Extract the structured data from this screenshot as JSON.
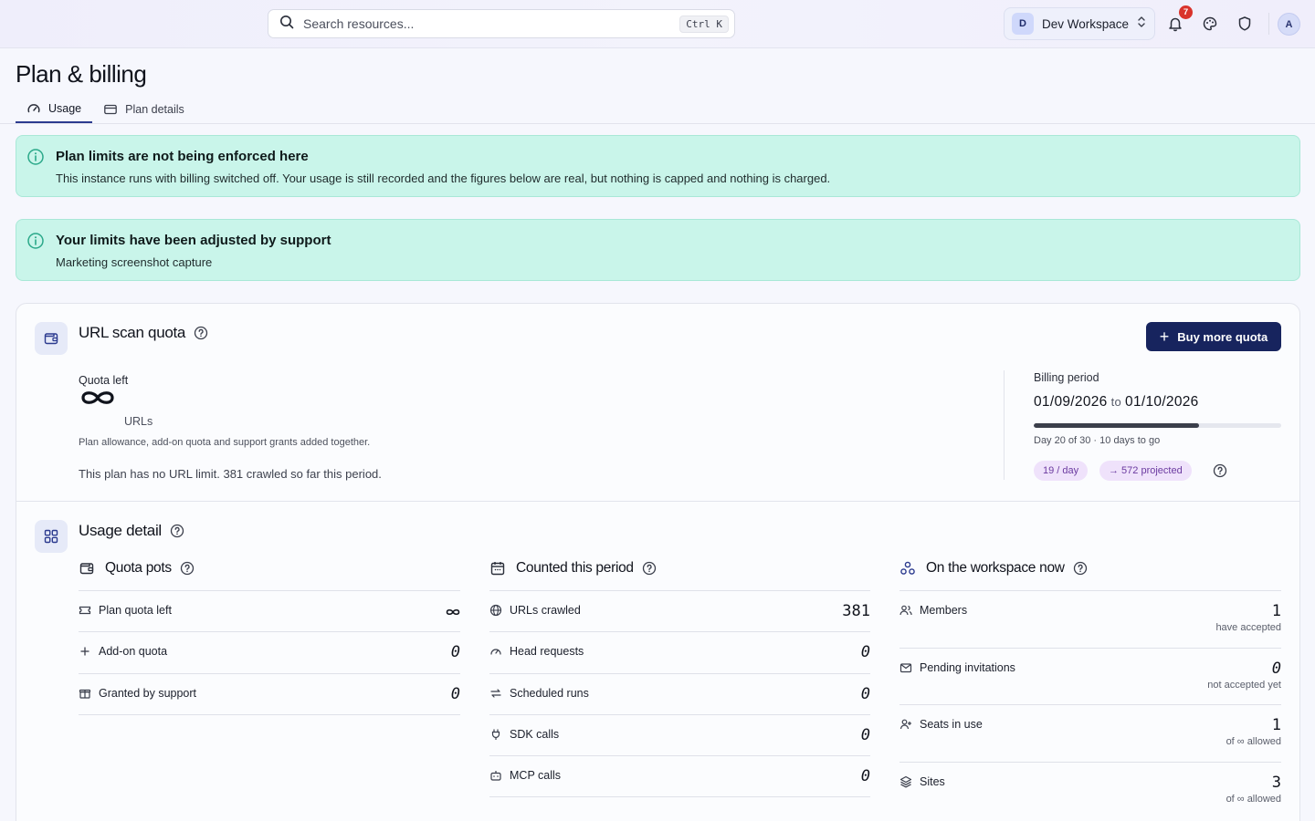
{
  "topbar": {
    "search_placeholder": "Search resources...",
    "search_shortcut": "Ctrl K",
    "workspace_initial": "D",
    "workspace_name": "Dev Workspace",
    "notification_count": "7",
    "user_initial": "A"
  },
  "page": {
    "title": "Plan & billing",
    "tabs": [
      {
        "label": "Usage",
        "icon": "gauge-icon",
        "active": true
      },
      {
        "label": "Plan details",
        "icon": "credit-card-icon",
        "active": false
      }
    ]
  },
  "alerts": [
    {
      "title": "Plan limits are not being enforced here",
      "body": "This instance runs with billing switched off. Your usage is still recorded and the figures below are real, but nothing is capped and nothing is charged."
    },
    {
      "title": "Your limits have been adjusted by support",
      "body": "Marketing screenshot capture"
    }
  ],
  "quota": {
    "title": "URL scan quota",
    "buy_label": "Buy more quota",
    "quota_left_label": "Quota left",
    "quota_left_value": "∞",
    "unit": "URLs",
    "sub": "Plan allowance, add-on quota and support grants added together.",
    "note": "This plan has no URL limit. 381 crawled so far this period.",
    "billing": {
      "label": "Billing period",
      "start": "01/09/2026",
      "to": "to",
      "end": "01/10/2026",
      "progress_fraction": 0.667,
      "days_text": "Day 20 of 30 · 10 days to go",
      "rate": "19 / day",
      "projected": "→ 572 projected"
    }
  },
  "usage": {
    "title": "Usage detail",
    "pots": {
      "title": "Quota pots",
      "rows": [
        {
          "label": "Plan quota left",
          "value": "∞",
          "icon": "ticket-icon"
        },
        {
          "label": "Add-on quota",
          "value": "0",
          "icon": "plus-icon"
        },
        {
          "label": "Granted by support",
          "value": "0",
          "icon": "gift-icon"
        }
      ]
    },
    "counted": {
      "title": "Counted this period",
      "rows": [
        {
          "label": "URLs crawled",
          "value": "381",
          "icon": "globe-icon"
        },
        {
          "label": "Head requests",
          "value": "0",
          "icon": "gauge-icon"
        },
        {
          "label": "Scheduled runs",
          "value": "0",
          "icon": "repeat-icon"
        },
        {
          "label": "SDK calls",
          "value": "0",
          "icon": "plug-icon"
        },
        {
          "label": "MCP calls",
          "value": "0",
          "icon": "bot-icon"
        }
      ]
    },
    "workspace": {
      "title": "On the workspace now",
      "rows": [
        {
          "label": "Members",
          "value": "1",
          "sub": "have accepted",
          "icon": "users-icon"
        },
        {
          "label": "Pending invitations",
          "value": "0",
          "sub": "not accepted yet",
          "icon": "mail-icon"
        },
        {
          "label": "Seats in use",
          "value": "1",
          "sub": "of ∞ allowed",
          "icon": "user-plus-icon"
        },
        {
          "label": "Sites",
          "value": "3",
          "sub": "of ∞ allowed",
          "icon": "layers-icon"
        }
      ]
    }
  },
  "colors": {
    "accent": "#17245e",
    "alert_bg": "#c9f5ea",
    "badge": "#d9332b",
    "pill_bg": "#efe2fb"
  }
}
